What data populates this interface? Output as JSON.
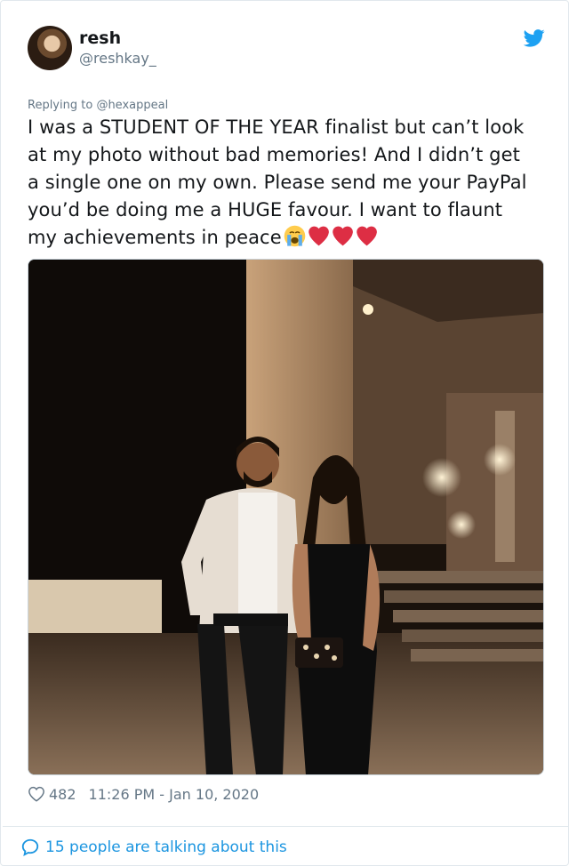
{
  "author": {
    "name": "resh",
    "handle": "@reshkay_"
  },
  "reply": {
    "prefix": "Replying to ",
    "mention": "@hexappeal"
  },
  "tweet": {
    "lines": [
      "I was a STUDENT OF THE YEAR finalist but can’t look",
      "at my photo without bad memories! And I didn’t get",
      "a single one on my own. Please send me your PayPal",
      "you’d be doing me a HUGE favour. I want to flaunt",
      "my achievements in peace"
    ],
    "emojis": [
      "loudly-crying-face-icon",
      "red-heart-icon",
      "red-heart-icon",
      "red-heart-icon"
    ]
  },
  "stats": {
    "likes": "482",
    "timestamp": "11:26 PM - Jan 10, 2020"
  },
  "conversation": {
    "label": "15 people are talking about this"
  },
  "colors": {
    "twitter_blue": "#1da1f2",
    "link_blue": "#1b95e0",
    "secondary_text": "#657786",
    "heart_red": "#e0245e"
  }
}
